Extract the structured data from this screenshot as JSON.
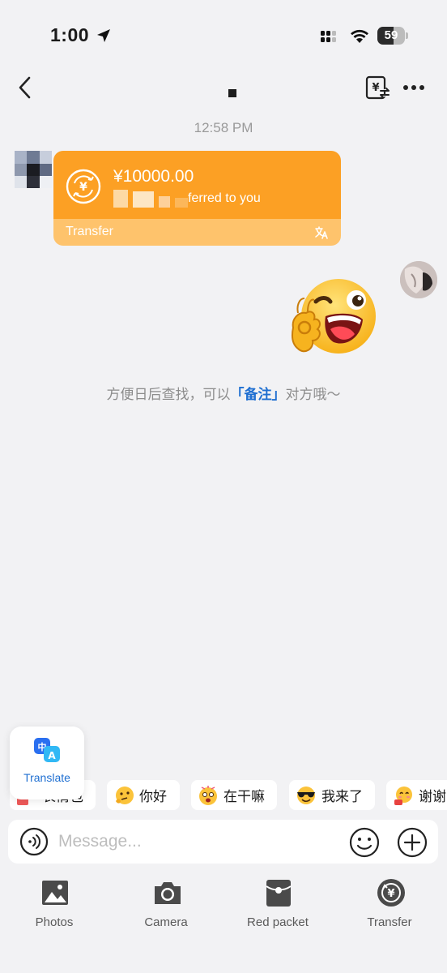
{
  "status_bar": {
    "time": "1:00",
    "battery_level": "59",
    "battery_fraction": 0.59
  },
  "nav": {
    "title": ""
  },
  "chat": {
    "timestamp": "12:58 PM",
    "transfer_card": {
      "amount": "¥10000.00",
      "description": "ferred to you",
      "label": "Transfer"
    },
    "hint": {
      "prefix": "方便日后查找，可以",
      "link": "「备注」",
      "suffix": "对方哦～"
    }
  },
  "translate_popup": {
    "label": "Translate"
  },
  "quick_replies": [
    {
      "label": "表情包",
      "emoji": "red-sticker-icon"
    },
    {
      "label": "你好",
      "emoji": "thinking-face-icon"
    },
    {
      "label": "在干嘛",
      "emoji": "dizzy-face-icon"
    },
    {
      "label": "我来了",
      "emoji": "sunglasses-face-icon"
    },
    {
      "label": "谢谢",
      "emoji": "thanks-face-icon"
    }
  ],
  "input": {
    "placeholder": "Message..."
  },
  "toolbar": {
    "items": [
      {
        "label": "Photos",
        "icon": "photo-icon"
      },
      {
        "label": "Camera",
        "icon": "camera-icon"
      },
      {
        "label": "Red packet",
        "icon": "red-packet-icon"
      },
      {
        "label": "Transfer",
        "icon": "transfer-icon"
      }
    ]
  },
  "colors": {
    "accent_orange": "#fca024",
    "accent_orange_light": "#fec36c",
    "link_blue": "#1f6fd1",
    "background": "#f2f2f4"
  }
}
